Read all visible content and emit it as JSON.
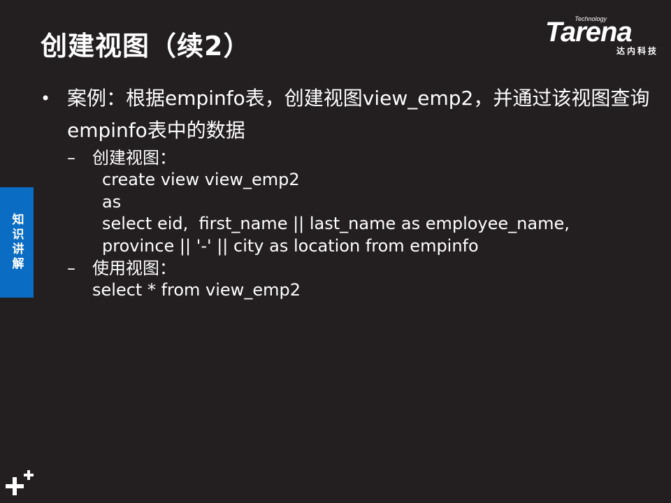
{
  "slide": {
    "title": "创建视图（续2）",
    "logo": {
      "tagline": "Technology",
      "wordmark": "Tarena",
      "chinese": "达内科技"
    },
    "side_tab": "知识讲解",
    "bullet": {
      "text": "案例：根据empinfo表，创建视图view_emp2，并通过该视图查询empinfo表中的数据"
    },
    "sub1": {
      "label": "创建视图：",
      "code": [
        "create view view_emp2",
        "as",
        "select eid,  first_name || last_name as employee_name,",
        "province || '-' || city as location from empinfo"
      ]
    },
    "sub2": {
      "label": "使用视图：",
      "code": [
        "select * from view_emp2"
      ]
    },
    "icons": {
      "bullet": "bullet-dot-icon",
      "corner": "plus-plus-icon"
    },
    "colors": {
      "background": "#231f20",
      "accent": "#0a6cc2",
      "text": "#ffffff"
    }
  }
}
